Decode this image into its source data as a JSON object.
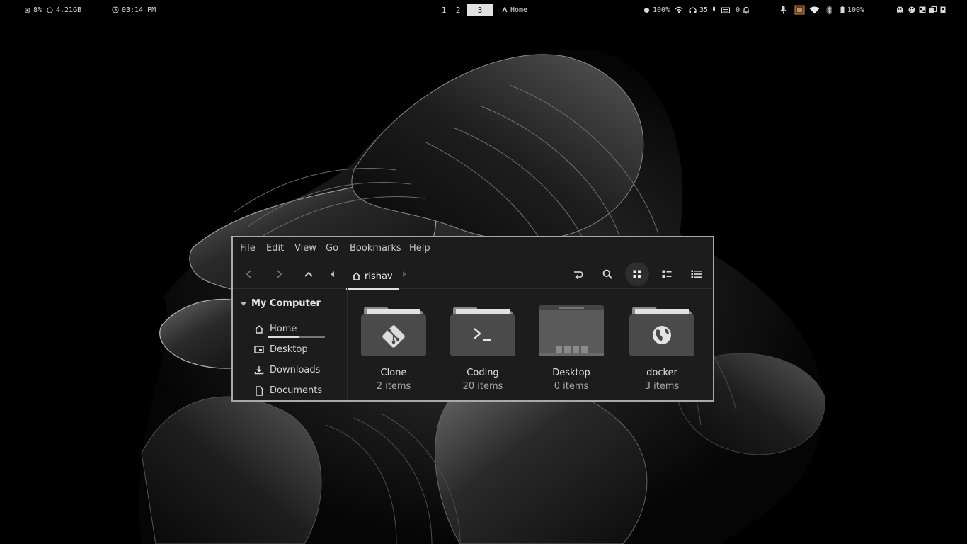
{
  "topbar": {
    "cpu": "8%",
    "memory": "4.21GB",
    "clock": "03:14 PM",
    "workspaces": [
      "1",
      "2",
      "3"
    ],
    "active_workspace": "3",
    "window_title": "Home",
    "brightness": "100%",
    "headphone_volume": "35",
    "notifications": "0",
    "battery": "100%",
    "icons": [
      "cpu-icon",
      "memory-icon",
      "clock-icon",
      "brightness-icon",
      "wifi-icon",
      "headphones-icon",
      "mic-icon",
      "keyboard-icon",
      "bell-icon",
      "microphone-icon",
      "chip-icon",
      "wifi-signal-icon",
      "bluetooth-icon",
      "battery-icon",
      "ghost-icon",
      "palette-icon",
      "layout-icon",
      "clipboard-icon",
      "power-icon"
    ]
  },
  "file_manager": {
    "menu": [
      "File",
      "Edit",
      "View",
      "Go",
      "Bookmarks",
      "Help"
    ],
    "breadcrumb": "rishav",
    "sidebar": {
      "section": "My Computer",
      "items": [
        {
          "label": "Home",
          "icon": "home-icon"
        },
        {
          "label": "Desktop",
          "icon": "desktop-icon"
        },
        {
          "label": "Downloads",
          "icon": "download-icon"
        },
        {
          "label": "Documents",
          "icon": "document-icon"
        }
      ]
    },
    "folders": [
      {
        "name": "Clone",
        "count": "2 items",
        "icon": "git-folder-icon"
      },
      {
        "name": "Coding",
        "count": "20 items",
        "icon": "terminal-folder-icon"
      },
      {
        "name": "Desktop",
        "count": "0 items",
        "icon": "desktop-folder-icon"
      },
      {
        "name": "docker",
        "count": "3 items",
        "icon": "globe-folder-icon"
      }
    ]
  },
  "colors": {
    "bar_text": "#d8d8d8",
    "window_border": "#a9a9a9",
    "window_bg": "#1c1c1c",
    "folder_body": "#4a4a4a",
    "folder_tab": "#5c5c5c"
  }
}
